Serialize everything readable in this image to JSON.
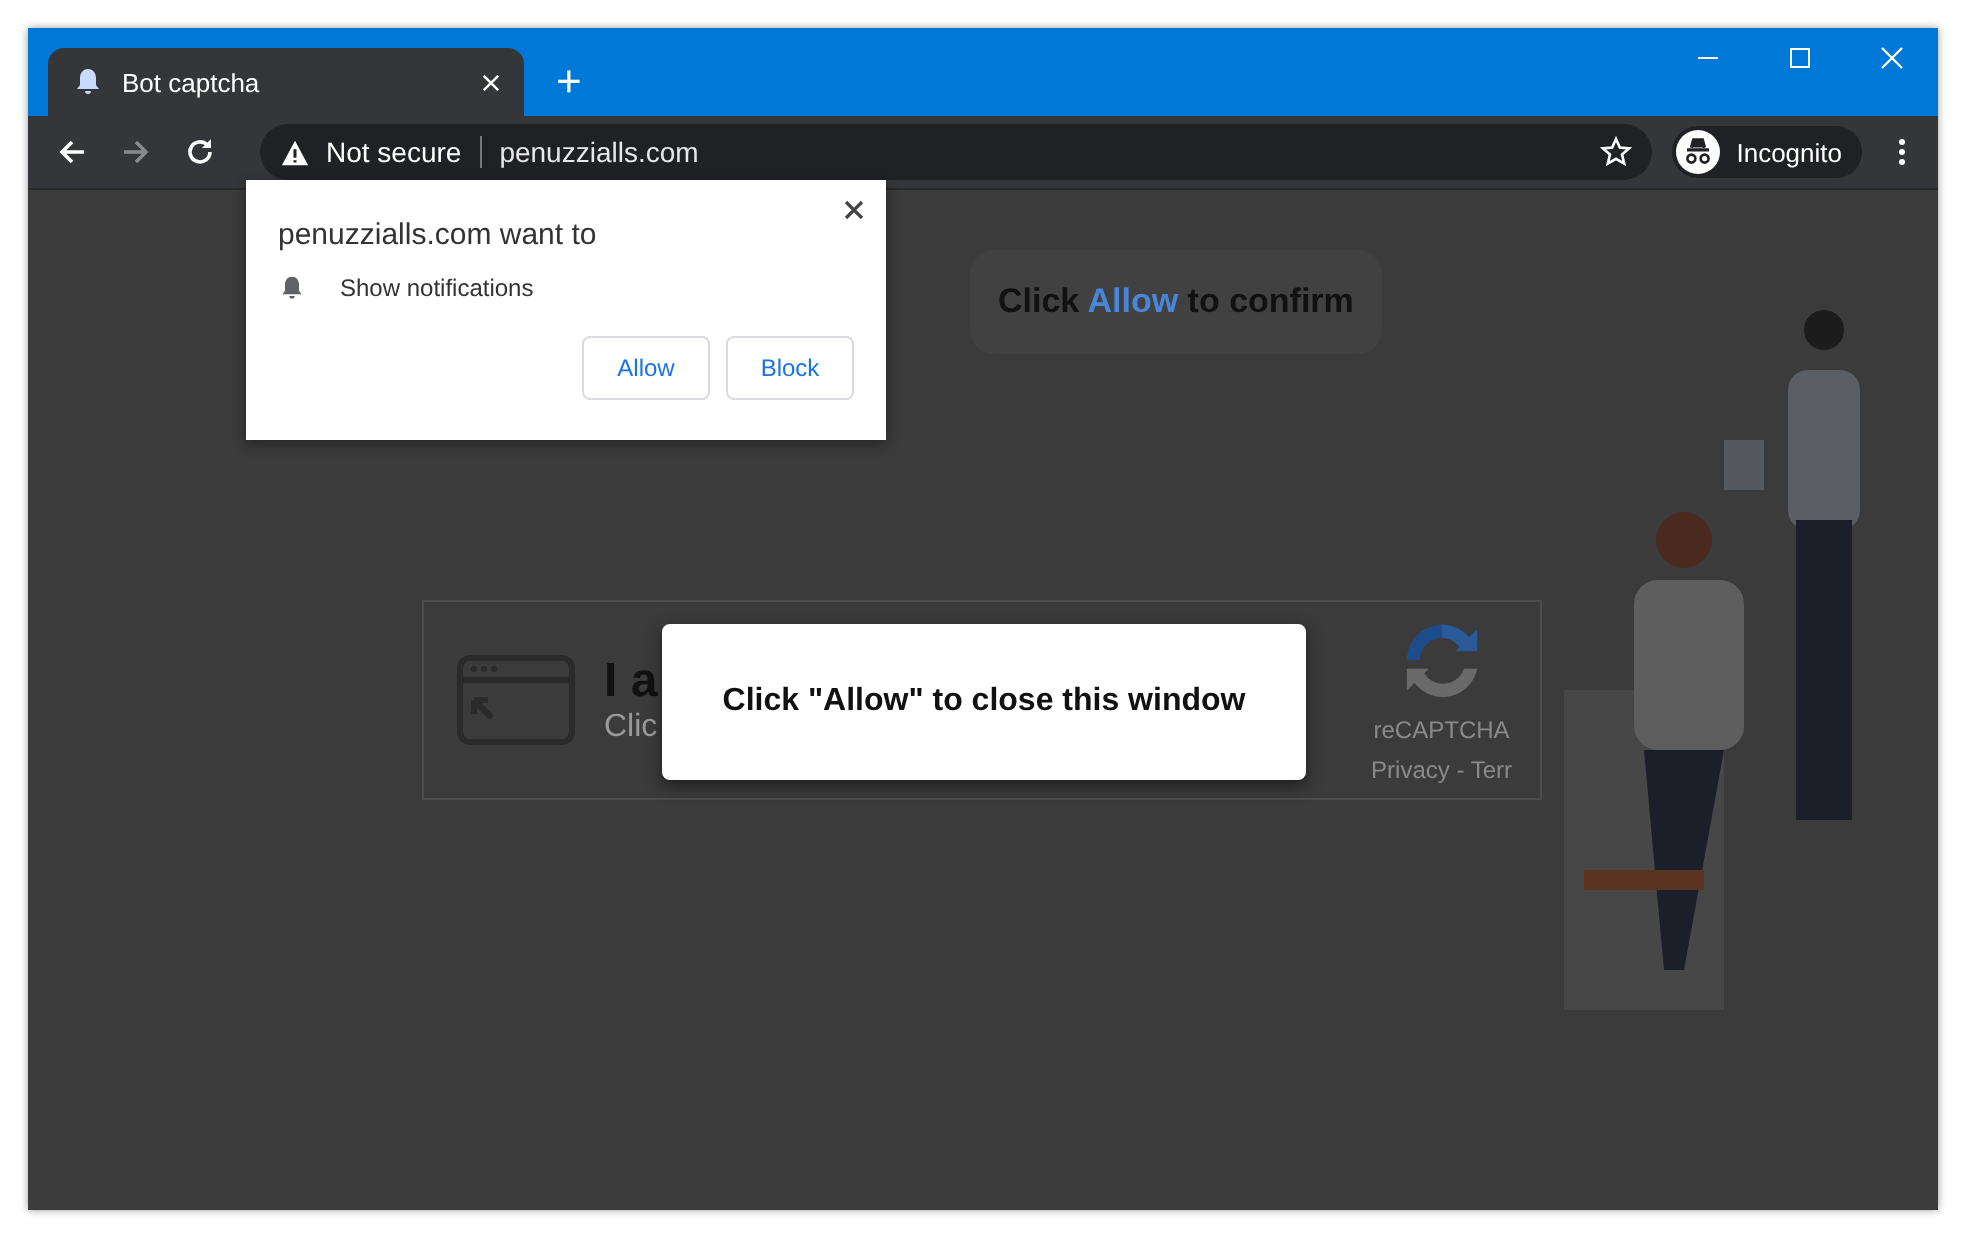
{
  "window": {
    "tabs": [
      {
        "title": "Bot captcha",
        "selected": true
      }
    ],
    "new_tab": "+"
  },
  "toolbar": {
    "security": "Not secure",
    "url": "penuzzialls.com",
    "profile": "Incognito"
  },
  "permission_prompt": {
    "title": "penuzzialls.com want to",
    "item": "Show notifications",
    "buttons": [
      "Allow",
      "Block"
    ]
  },
  "page": {
    "confirm_banner": {
      "before": "Click",
      "highlight": "Allow",
      "after": "to confirm"
    },
    "captcha": {
      "heading": "I a",
      "subtext": "Clic",
      "brand": "reCAPTCHA",
      "links": "Privacy - Terr"
    },
    "modal": {
      "message": "Click \"Allow\" to close this window"
    }
  }
}
